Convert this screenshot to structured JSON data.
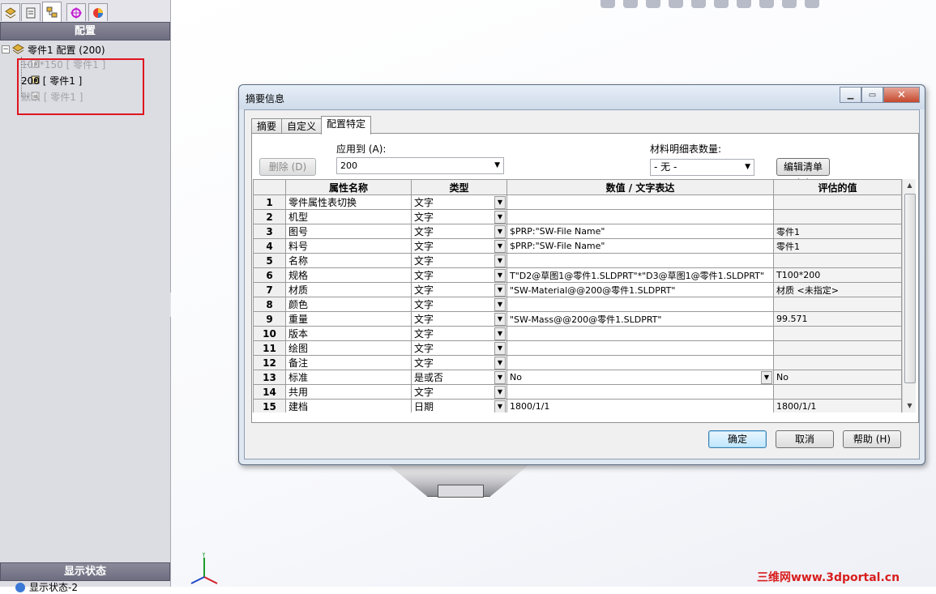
{
  "left_panel": {
    "header": "配置",
    "root": "零件1 配置  (200)",
    "configs": [
      {
        "label": "100*150 [ 零件1 ]",
        "active": false
      },
      {
        "label": "200 [ 零件1 ]",
        "active": true
      },
      {
        "label": "默认 [ 零件1 ]",
        "active": false
      }
    ],
    "bottom_header": "显示状态",
    "bottom_item": "显示状态-2"
  },
  "dialog": {
    "title": "摘要信息",
    "tabs": [
      "摘要",
      "自定义",
      "配置特定"
    ],
    "active_tab": "配置特定",
    "delete_button": "删除 (D)",
    "apply_to_label": "应用到 (A):",
    "apply_to_value": "200",
    "bom_qty_label": "材料明细表数量:",
    "bom_qty_value": "- 无 -",
    "edit_list_button": "编辑清单 (E)",
    "columns": [
      "属性名称",
      "类型",
      "数值 / 文字表达",
      "评估的值"
    ],
    "rows": [
      {
        "num": "1",
        "name": "零件属性表切换",
        "type": "文字",
        "value": "",
        "evaluated": ""
      },
      {
        "num": "2",
        "name": "机型",
        "type": "文字",
        "value": "",
        "evaluated": ""
      },
      {
        "num": "3",
        "name": "图号",
        "type": "文字",
        "value": "$PRP:\"SW-File Name\"",
        "evaluated": "零件1"
      },
      {
        "num": "4",
        "name": "料号",
        "type": "文字",
        "value": "$PRP:\"SW-File Name\"",
        "evaluated": "零件1"
      },
      {
        "num": "5",
        "name": "名称",
        "type": "文字",
        "value": "",
        "evaluated": ""
      },
      {
        "num": "6",
        "name": "规格",
        "type": "文字",
        "value": "T\"D2@草图1@零件1.SLDPRT\"*\"D3@草图1@零件1.SLDPRT\"",
        "evaluated": "T100*200"
      },
      {
        "num": "7",
        "name": "材质",
        "type": "文字",
        "value": "\"SW-Material@@200@零件1.SLDPRT\"",
        "evaluated": "材质 <未指定>"
      },
      {
        "num": "8",
        "name": "颜色",
        "type": "文字",
        "value": "",
        "evaluated": ""
      },
      {
        "num": "9",
        "name": "重量",
        "type": "文字",
        "value": "\"SW-Mass@@200@零件1.SLDPRT\"",
        "evaluated": "99.571"
      },
      {
        "num": "10",
        "name": "版本",
        "type": "文字",
        "value": "",
        "evaluated": ""
      },
      {
        "num": "11",
        "name": "绘图",
        "type": "文字",
        "value": "",
        "evaluated": ""
      },
      {
        "num": "12",
        "name": "备注",
        "type": "文字",
        "value": "",
        "evaluated": ""
      },
      {
        "num": "13",
        "name": "标准",
        "type": "是或否",
        "value": "No",
        "evaluated": "No"
      },
      {
        "num": "14",
        "name": "共用",
        "type": "文字",
        "value": "",
        "evaluated": ""
      },
      {
        "num": "15",
        "name": "建档",
        "type": "日期",
        "value": "1800/1/1",
        "evaluated": "1800/1/1"
      }
    ],
    "ok_button": "确定",
    "cancel_button": "取消",
    "help_button": "帮助 (H)"
  },
  "watermark": "三维网www.3dportal.cn",
  "colors": {
    "highlight": "#e0141e",
    "panel_header": "#6d6d80",
    "dialog_frame": "#dfe7f1"
  }
}
